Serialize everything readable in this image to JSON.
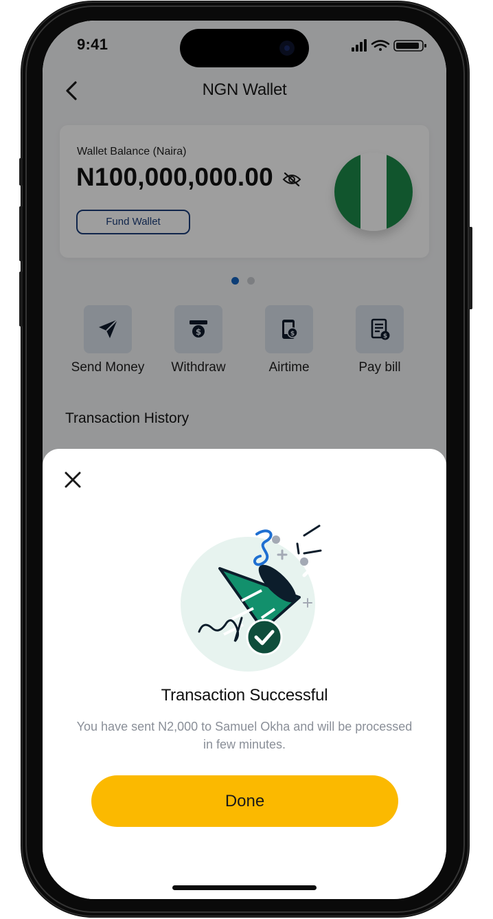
{
  "status_bar": {
    "time": "9:41"
  },
  "header": {
    "title": "NGN Wallet"
  },
  "wallet": {
    "balance_label": "Wallet Balance (Naira)",
    "balance_amount": "N100,000,000.00",
    "fund_label": "Fund Wallet",
    "flag_colors": [
      "#1c8a4a",
      "#ffffff",
      "#1c8a4a"
    ]
  },
  "carousel": {
    "pages": 2,
    "active": 1
  },
  "actions": [
    {
      "label": "Send Money",
      "icon": "send-icon"
    },
    {
      "label": "Withdraw",
      "icon": "withdraw-icon"
    },
    {
      "label": "Airtime",
      "icon": "airtime-icon"
    },
    {
      "label": "Pay bill",
      "icon": "bill-icon"
    }
  ],
  "history": {
    "title": "Transaction History"
  },
  "modal": {
    "title": "Transaction Successful",
    "message": "You have sent N2,000 to Samuel Okha and will be processed in few minutes.",
    "button_label": "Done",
    "illustration": "party-popper-success-illustration"
  },
  "colors": {
    "accent": "#fbb900",
    "brand_blue": "#1a3d7a",
    "success_green": "#12906c",
    "dark_green": "#0f4d3b"
  }
}
